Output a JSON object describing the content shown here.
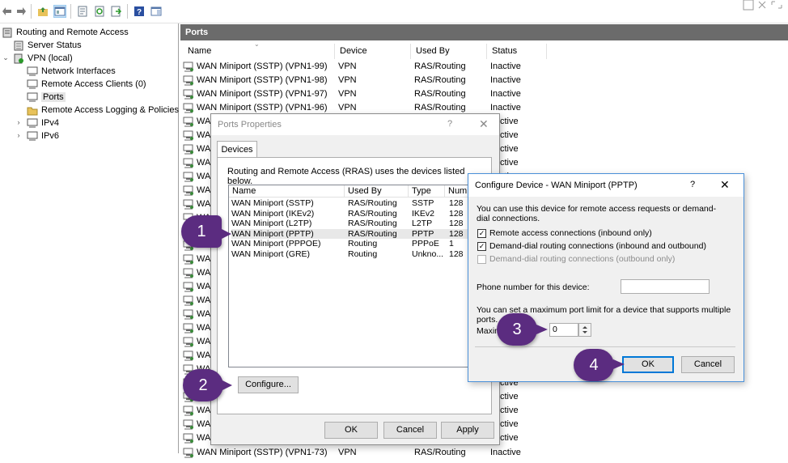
{
  "colors": {
    "badge": "#5b2c80",
    "pane_header": "#6b6b6b",
    "selection": "#cce4f7"
  },
  "toolbar": {
    "icons": [
      "back-icon",
      "forward-icon",
      "folder-up-icon",
      "show-tree-icon",
      "properties-icon",
      "refresh-icon",
      "export-icon",
      "help-icon",
      "console-icon"
    ]
  },
  "tree": {
    "root": "Routing and Remote Access",
    "server_status": "Server Status",
    "vpn": "VPN (local)",
    "network_interfaces": "Network Interfaces",
    "remote_access_clients": "Remote Access Clients (0)",
    "ports": "Ports",
    "logging": "Remote Access Logging & Policies",
    "ipv4": "IPv4",
    "ipv6": "IPv6"
  },
  "ports_pane": {
    "title": "Ports",
    "columns": [
      "Name",
      "Device",
      "Used By",
      "Status"
    ],
    "rows": [
      {
        "name": "WAN Miniport (SSTP) (VPN1-99)",
        "device": "VPN",
        "used_by": "RAS/Routing",
        "status": "Inactive"
      },
      {
        "name": "WAN Miniport (SSTP) (VPN1-98)",
        "device": "VPN",
        "used_by": "RAS/Routing",
        "status": "Inactive"
      },
      {
        "name": "WAN Miniport (SSTP) (VPN1-97)",
        "device": "VPN",
        "used_by": "RAS/Routing",
        "status": "Inactive"
      },
      {
        "name": "WAN Miniport (SSTP) (VPN1-96)",
        "device": "VPN",
        "used_by": "RAS/Routing",
        "status": "Inactive"
      }
    ],
    "partial_name": "WA",
    "partial_status": "ctive",
    "bottom_row": {
      "name": "WAN Miniport (SSTP) (VPN1-73)",
      "device": "VPN",
      "used_by": "RAS/Routing",
      "status": "Inactive"
    }
  },
  "ports_properties": {
    "title": "Ports Properties",
    "help": "?",
    "close": "✕",
    "tab": "Devices",
    "description": "Routing and Remote Access (RRAS) uses the devices listed below.",
    "columns": [
      "Name",
      "Used By",
      "Type",
      "Number"
    ],
    "devices": [
      {
        "name": "WAN Miniport (SSTP)",
        "used_by": "RAS/Routing",
        "type": "SSTP",
        "number": "128"
      },
      {
        "name": "WAN Miniport (IKEv2)",
        "used_by": "RAS/Routing",
        "type": "IKEv2",
        "number": "128"
      },
      {
        "name": "WAN Miniport (L2TP)",
        "used_by": "RAS/Routing",
        "type": "L2TP",
        "number": "128"
      },
      {
        "name": "WAN Miniport (PPTP)",
        "used_by": "RAS/Routing",
        "type": "PPTP",
        "number": "128"
      },
      {
        "name": "WAN Miniport (PPPOE)",
        "used_by": "Routing",
        "type": "PPPoE",
        "number": "1"
      },
      {
        "name": "WAN Miniport (GRE)",
        "used_by": "Routing",
        "type": "Unkno...",
        "number": "128"
      }
    ],
    "configure": "Configure...",
    "ok": "OK",
    "cancel": "Cancel",
    "apply": "Apply"
  },
  "configure_device": {
    "title": "Configure Device - WAN Miniport (PPTP)",
    "help": "?",
    "close": "✕",
    "intro": "You can use this device for remote access requests or demand-dial connections.",
    "opt_remote": "Remote access connections (inbound only)",
    "opt_demand": "Demand-dial routing connections (inbound and outbound)",
    "opt_outbound": "Demand-dial routing connections (outbound only)",
    "phone_label": "Phone number for this device:",
    "phone_value": "",
    "max_text": "You can set a maximum port limit for a device that supports multiple ports.",
    "max_label": "Maxim",
    "max_value": "0",
    "ok": "OK",
    "cancel": "Cancel"
  },
  "steps": [
    "1",
    "2",
    "3",
    "4"
  ]
}
